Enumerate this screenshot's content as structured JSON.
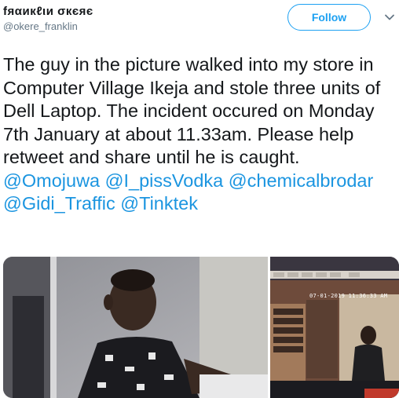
{
  "author": {
    "display_name": "fяαикℓιи σкєяє",
    "handle": "@okere_franklin"
  },
  "actions": {
    "follow_label": "Follow",
    "caret_icon": "chevron-down-icon"
  },
  "tweet": {
    "text_plain": "The guy in the picture walked into my store in Computer Village Ikeja and stole three units of Dell Laptop. The incident occured on Monday 7th January at about 11.33am. Please help retweet and share until he is caught.",
    "mentions": [
      "@Omojuwa",
      "@I_pissVodka",
      "@chemicalbrodar",
      "@Gidi_Traffic",
      "@Tinktek"
    ]
  },
  "media": {
    "right_overlay_timestamp": "07-01-2019 11:36:33 AM"
  },
  "colors": {
    "brand_blue": "#1da1f2",
    "mention_blue": "#1b95e0",
    "text_primary": "#14171a",
    "text_secondary": "#657786"
  }
}
